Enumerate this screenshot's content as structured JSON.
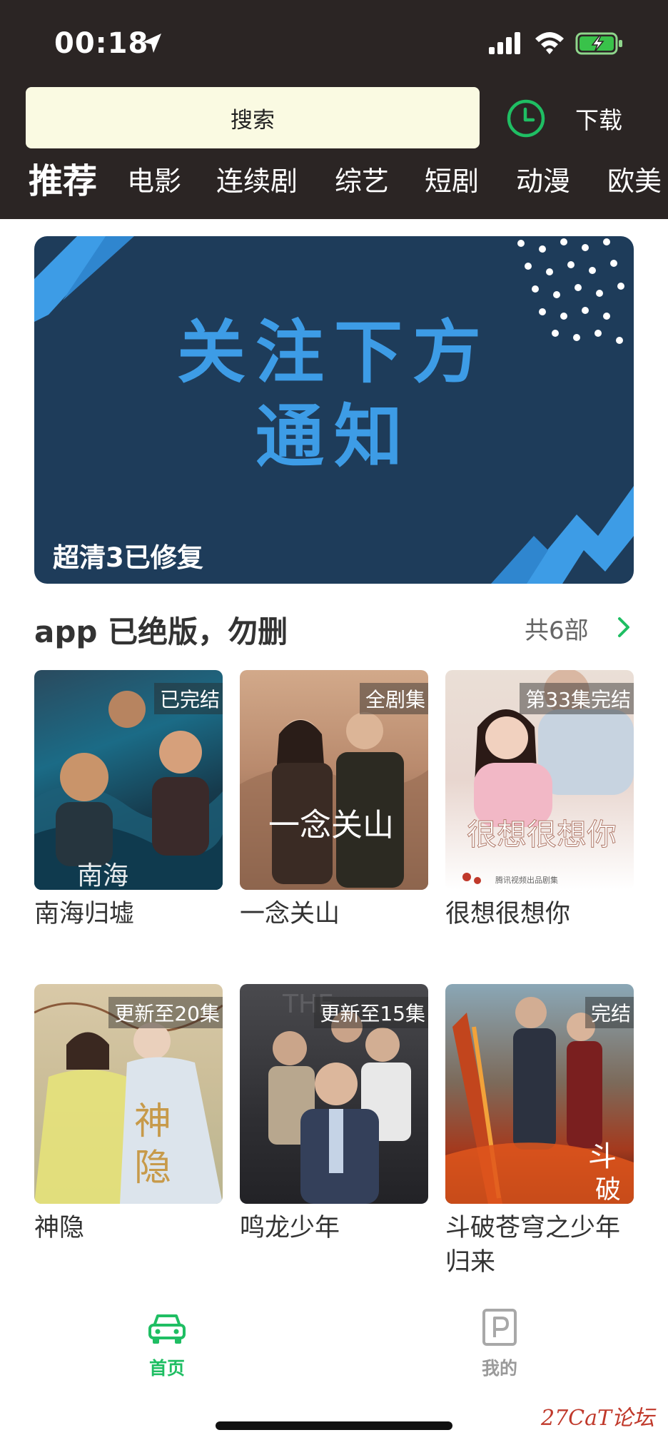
{
  "status_bar": {
    "time": "00:18",
    "icons": [
      "location-icon",
      "signal-icon",
      "wifi-icon",
      "battery-charging-icon"
    ]
  },
  "header": {
    "search_label": "搜索",
    "download_label": "下载",
    "history_icon": "clock-icon",
    "tabs": [
      "推荐",
      "电影",
      "连续剧",
      "综艺",
      "短剧",
      "动漫",
      "欧美"
    ]
  },
  "banner": {
    "line1": "关注下方",
    "line2": "通知",
    "caption": "超清3已修复"
  },
  "section": {
    "title": "app 已绝版，勿删",
    "more": "共6部"
  },
  "items": [
    {
      "title": "南海归墟",
      "badge": "已完结"
    },
    {
      "title": "一念关山",
      "badge": "全剧集"
    },
    {
      "title": "很想很想你",
      "badge": "第33集完结"
    },
    {
      "title": "神隐",
      "badge": "更新至20集"
    },
    {
      "title": "鸣龙少年",
      "badge": "更新至15集"
    },
    {
      "title": "斗破苍穹之少年归来",
      "badge": "完结"
    }
  ],
  "bottom_nav": [
    {
      "label": "首页",
      "icon": "car-home-icon",
      "active": true
    },
    {
      "label": "我的",
      "icon": "parking-profile-icon",
      "active": false
    }
  ],
  "watermark": "27CaT论坛",
  "colors": {
    "header_bg": "#2b2524",
    "accent": "#1fbe63",
    "banner_bg": "#1e3c5a",
    "banner_text": "#3d9ce6"
  }
}
